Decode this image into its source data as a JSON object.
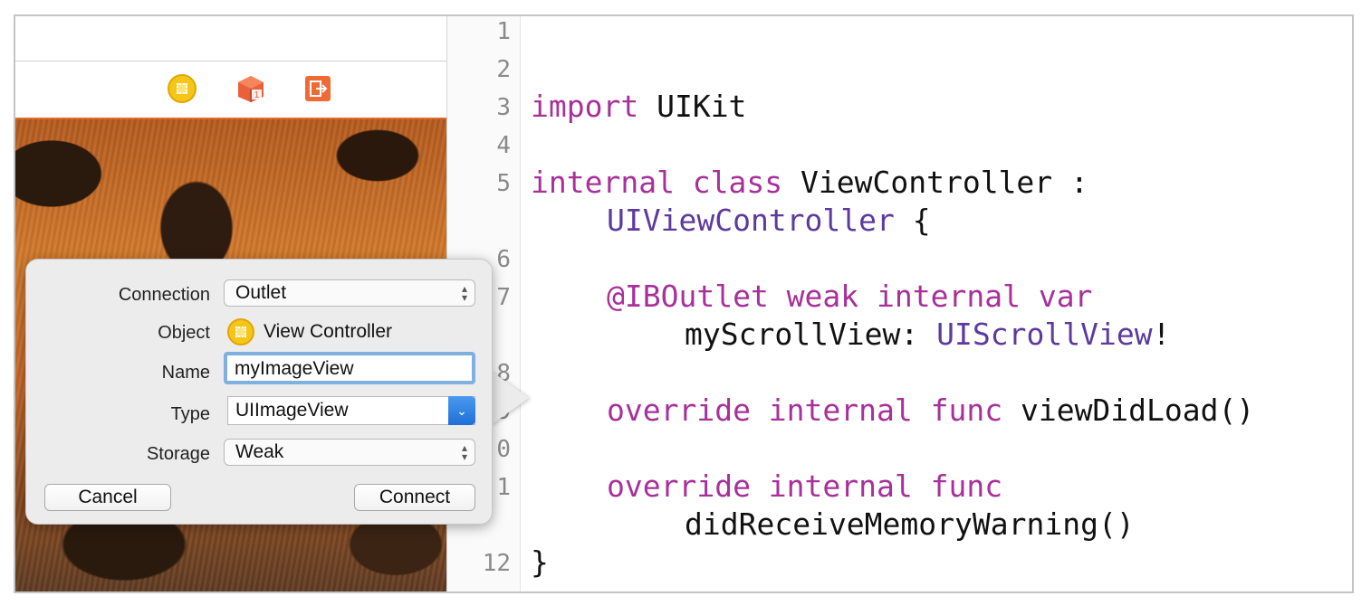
{
  "storyboard": {
    "scene_icons": [
      "view-controller-icon",
      "first-responder-icon",
      "exit-icon"
    ]
  },
  "popover": {
    "connection": {
      "label": "Connection",
      "value": "Outlet"
    },
    "object": {
      "label": "Object",
      "value": "View Controller"
    },
    "name": {
      "label": "Name",
      "value": "myImageView"
    },
    "type": {
      "label": "Type",
      "value": "UIImageView"
    },
    "storage": {
      "label": "Storage",
      "value": "Weak"
    },
    "cancel_label": "Cancel",
    "connect_label": "Connect"
  },
  "editor": {
    "line_numbers": [
      "1",
      "2",
      "3",
      "4",
      "5",
      "6",
      "7",
      "8",
      "9",
      "0",
      "1",
      "12"
    ],
    "code": {
      "l3_kw": "import",
      "l3_rest": " UIKit",
      "l5_kw": "internal class",
      "l5_rest": " ViewController :",
      "l5_type": "UIViewController",
      "l5_brace": " {",
      "l7_kw": "@IBOutlet weak internal var",
      "l7_name": "myScrollView: ",
      "l7_type": "UIScrollView",
      "l7_bang": "!",
      "l9_kw": "override internal func",
      "l9_rest": " viewDidLoad()",
      "l11_kw": "override internal func",
      "l11_rest": "didReceiveMemoryWarning()",
      "l12": "}"
    }
  },
  "colors": {
    "keyword": "#a8309a",
    "type": "#5d3a9e",
    "accent": "#1f6fd6",
    "scene_bar": "#e36a2a"
  }
}
